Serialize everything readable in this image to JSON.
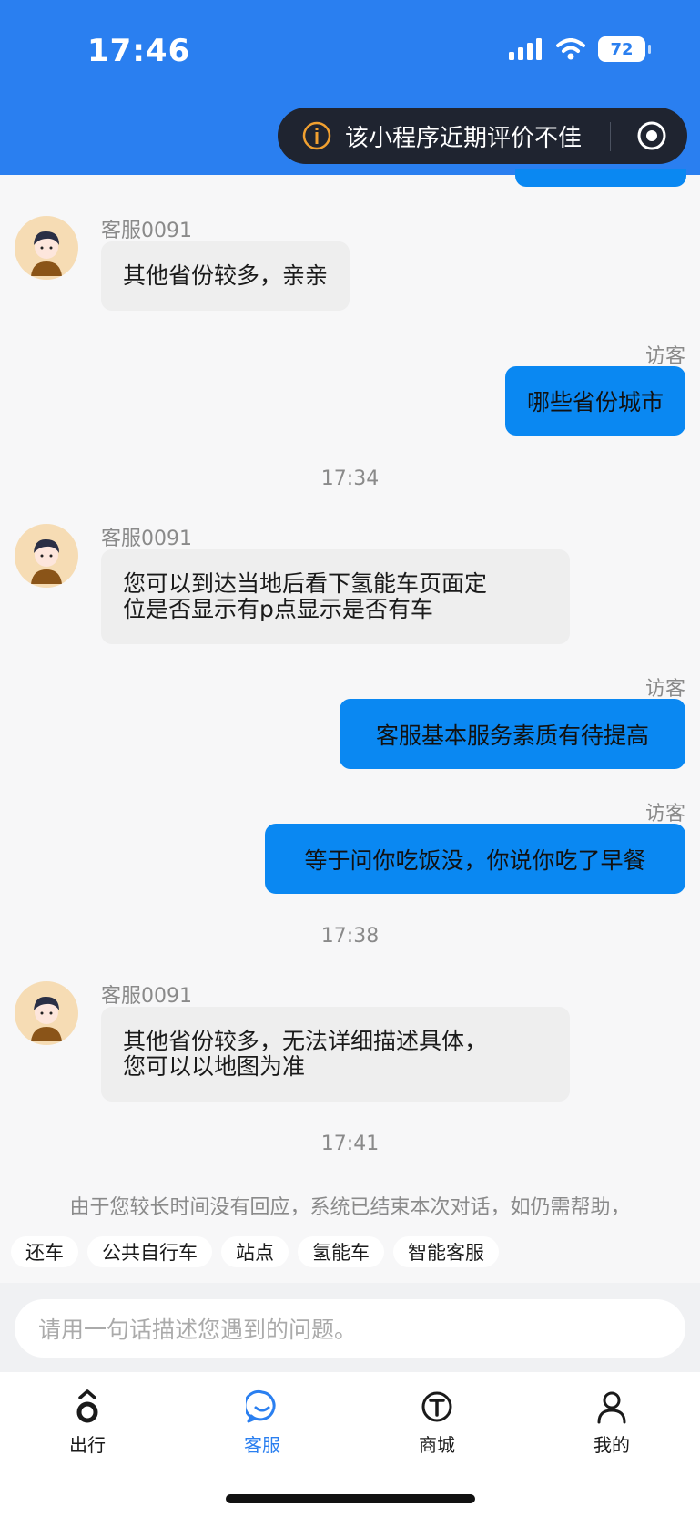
{
  "status_bar": {
    "time": "17:46",
    "battery": "72"
  },
  "notice": {
    "text": "该小程序近期评价不佳"
  },
  "messages": [
    {
      "type": "agent",
      "name": "客服0091",
      "text": "其他省份较多，亲亲"
    },
    {
      "type": "visitor",
      "label": "访客",
      "text": "哪些省份城市"
    },
    {
      "type": "time",
      "text": "17:34"
    },
    {
      "type": "agent",
      "name": "客服0091",
      "line1": "您可以到达当地后看下氢能车页面定",
      "line2": "位是否显示有p点显示是否有车"
    },
    {
      "type": "visitor",
      "label": "访客",
      "text": "客服基本服务素质有待提高"
    },
    {
      "type": "visitor",
      "label": "访客",
      "text": "等于问你吃饭没，你说你吃了早餐"
    },
    {
      "type": "time",
      "text": "17:38"
    },
    {
      "type": "agent",
      "name": "客服0091",
      "line1": "其他省份较多，无法详细描述具体，",
      "line2": "您可以以地图为准"
    },
    {
      "type": "time",
      "text": "17:41"
    }
  ],
  "system_message": "由于您较长时间没有回应，系统已结束本次对话，如仍需帮助，",
  "quick_chips": [
    "还车",
    "公共自行车",
    "站点",
    "氢能车",
    "智能客服"
  ],
  "input": {
    "placeholder": "请用一句话描述您遇到的问题。"
  },
  "tabs": [
    {
      "label": "出行",
      "icon": "travel-icon",
      "active": false
    },
    {
      "label": "客服",
      "icon": "service-chat-icon",
      "active": true
    },
    {
      "label": "商城",
      "icon": "mall-icon",
      "active": false
    },
    {
      "label": "我的",
      "icon": "profile-icon",
      "active": false
    }
  ],
  "colors": {
    "header": "#2a7ff0",
    "visitor_bubble": "#0a88f2",
    "agent_bubble": "#eeeeee",
    "active_tab": "#2a7ff0"
  }
}
